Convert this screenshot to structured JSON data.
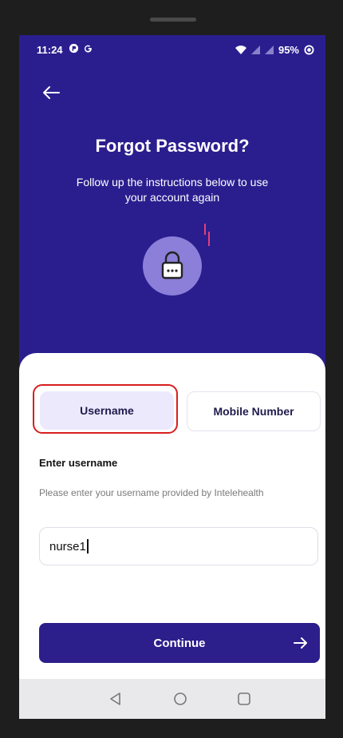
{
  "status": {
    "time": "11:24",
    "battery": "95%"
  },
  "header": {
    "title": "Forgot Password?",
    "subtitle": "Follow up the instructions below to use your account again"
  },
  "tabs": [
    {
      "label": "Username",
      "selected": true
    },
    {
      "label": "Mobile Number",
      "selected": false
    }
  ],
  "form": {
    "label": "Enter username",
    "hint": "Please enter your username provided by Intelehealth",
    "value": "nurse1"
  },
  "continue_button": {
    "label": "Continue"
  },
  "colors": {
    "primary": "#2c1e8b",
    "selected_tab": "#ece9fd",
    "highlight": "#d81e1e"
  }
}
